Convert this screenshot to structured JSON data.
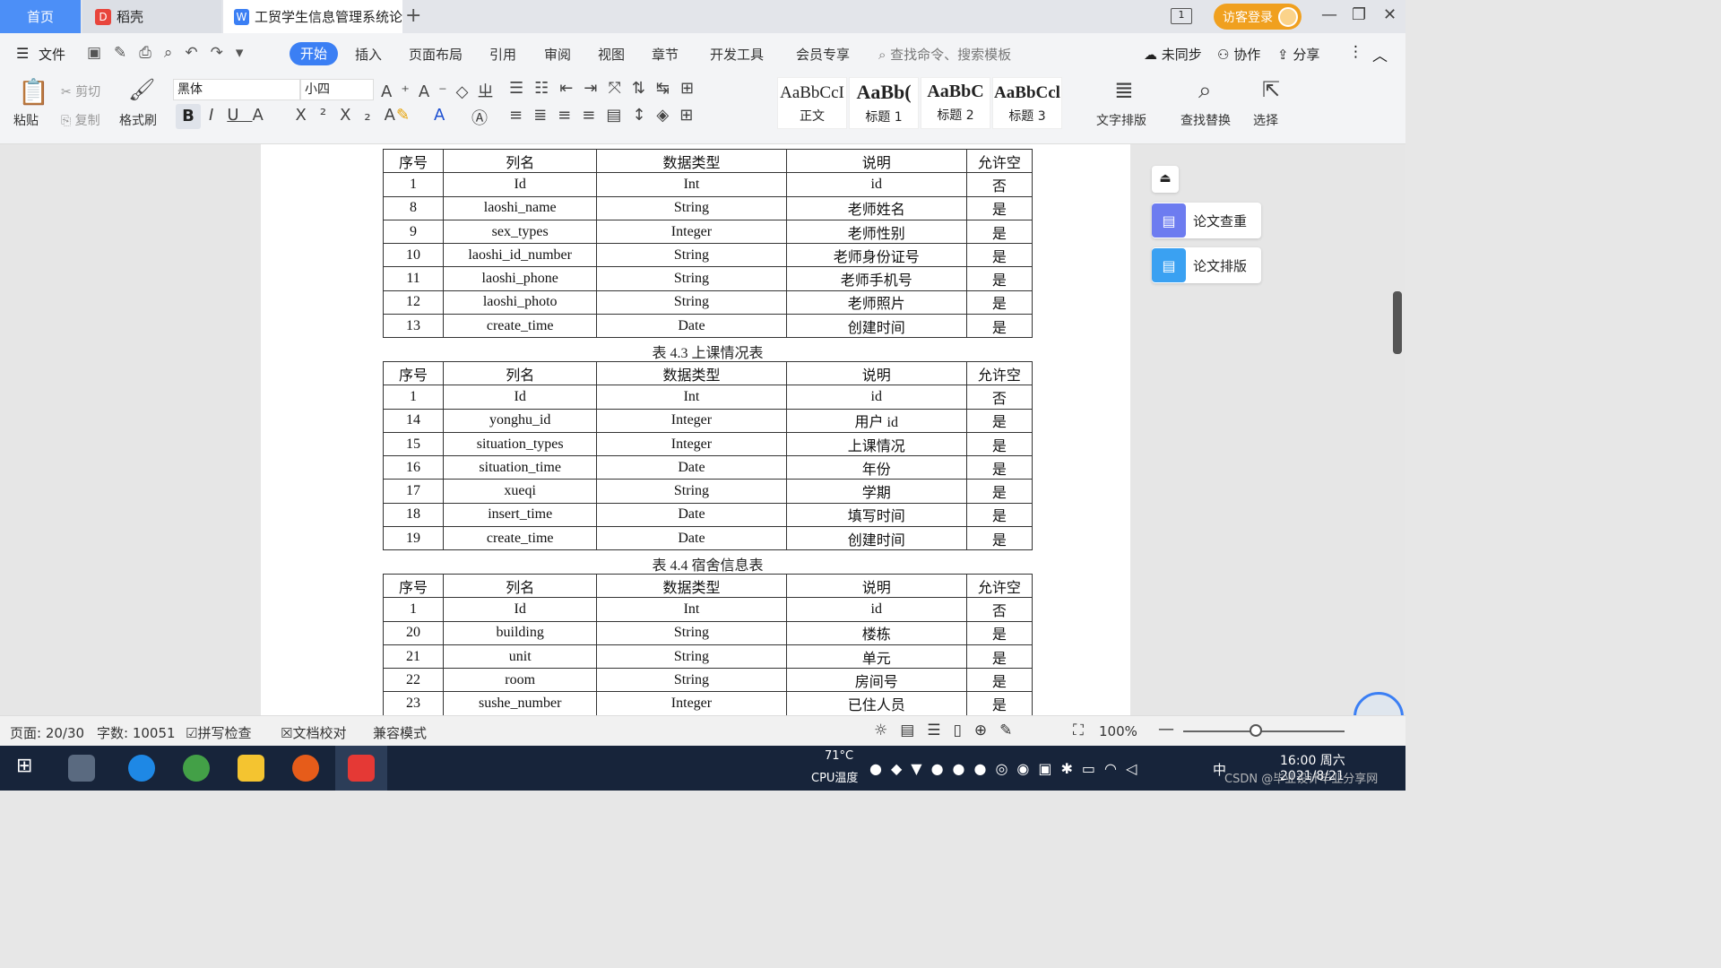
{
  "tabs": {
    "home": "首页",
    "daoke": "稻壳",
    "doc": "工贸学生信息管理系统论",
    "login": "访客登录"
  },
  "menu": {
    "file": "文件",
    "items": [
      "开始",
      "插入",
      "页面布局",
      "引用",
      "审阅",
      "视图",
      "章节",
      "开发工具",
      "会员专享"
    ],
    "search_placeholder": "查找命令、搜索模板",
    "unsynced": "未同步",
    "collab": "协作",
    "share": "分享"
  },
  "ribbon": {
    "paste": "粘贴",
    "cut": "剪切",
    "copy": "复制",
    "format_painter": "格式刷",
    "font": "黑体",
    "size": "小四",
    "styles": [
      {
        "preview": "AaBbCcI",
        "name": "正文"
      },
      {
        "preview": "AaBb(",
        "name": "标题 1"
      },
      {
        "preview": "AaBbC",
        "name": "标题 2"
      },
      {
        "preview": "AaBbCcl",
        "name": "标题 3"
      }
    ],
    "text_layout": "文字排版",
    "find_replace": "查找替换",
    "select": "选择"
  },
  "headers": [
    "序号",
    "列名",
    "数据类型",
    "说明",
    "允许空"
  ],
  "table1": [
    [
      "1",
      "Id",
      "Int",
      "id",
      "否"
    ],
    [
      "8",
      "laoshi_name",
      "String",
      "老师姓名",
      "是"
    ],
    [
      "9",
      "sex_types",
      "Integer",
      "老师性别",
      "是"
    ],
    [
      "10",
      "laoshi_id_number",
      "String",
      "老师身份证号",
      "是"
    ],
    [
      "11",
      "laoshi_phone",
      "String",
      "老师手机号",
      "是"
    ],
    [
      "12",
      "laoshi_photo",
      "String",
      "老师照片",
      "是"
    ],
    [
      "13",
      "create_time",
      "Date",
      "创建时间",
      "是"
    ]
  ],
  "caption2": "表 4.3 上课情况表",
  "table2": [
    [
      "1",
      "Id",
      "Int",
      "id",
      "否"
    ],
    [
      "14",
      "yonghu_id",
      "Integer",
      "用户 id",
      "是"
    ],
    [
      "15",
      "situation_types",
      "Integer",
      "上课情况",
      "是"
    ],
    [
      "16",
      "situation_time",
      "Date",
      "年份",
      "是"
    ],
    [
      "17",
      "xueqi",
      "String",
      "学期",
      "是"
    ],
    [
      "18",
      "insert_time",
      "Date",
      "填写时间",
      "是"
    ],
    [
      "19",
      "create_time",
      "Date",
      "创建时间",
      "是"
    ]
  ],
  "caption3": "表 4.4 宿舍信息表",
  "table3": [
    [
      "1",
      "Id",
      "Int",
      "id",
      "否"
    ],
    [
      "20",
      "building",
      "String",
      "楼栋",
      "是"
    ],
    [
      "21",
      "unit",
      "String",
      "单元",
      "是"
    ],
    [
      "22",
      "room",
      "String",
      "房间号",
      "是"
    ],
    [
      "23",
      "sushe_number",
      "Integer",
      "已住人员",
      "是"
    ]
  ],
  "side": {
    "check": "论文查重",
    "layout": "论文排版"
  },
  "status": {
    "page": "页面: 20/30",
    "words": "字数: 10051",
    "spell": "拼写检查",
    "proof": "文档校对",
    "compat": "兼容模式",
    "zoom": "100%"
  },
  "taskbar": {
    "cpu": "71°C",
    "cpu_label": "CPU温度",
    "time": "16:00 周六",
    "date": "2021/8/21",
    "ime": "中",
    "watermark": "CSDN @毕业设计毕业分享网"
  },
  "colors": {
    "accent": "#3b7ff4",
    "home_tab": "#4c8ff7",
    "login": "#f0a01f",
    "taskbar": "#17243a"
  }
}
